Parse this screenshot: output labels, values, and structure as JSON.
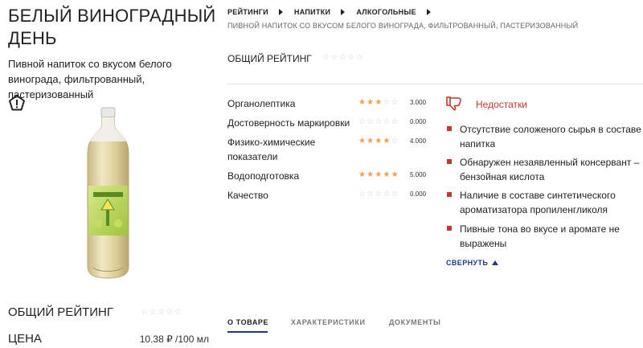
{
  "product": {
    "title": "БЕЛЫЙ ВИНОГРАДНЫЙ ДЕНЬ",
    "subtitle": "Пивной напиток со вкусом белого винограда, фильтрованный, пастеризованный",
    "overall_rating_label": "ОБЩИЙ РЕЙТИНГ",
    "overall_stars": "☆☆☆☆☆",
    "price_label": "ЦЕНА",
    "price_value": "10.38 ₽ /100 мл"
  },
  "breadcrumb": {
    "items": [
      "РЕЙТИНГИ",
      "НАПИТКИ",
      "АЛКОГОЛЬНЫЕ"
    ],
    "subline": "ПИВНОЙ НАПИТОК СО ВКУСОМ БЕЛОГО ВИНОГРАДА, ФИЛЬТРОВАННЫЙ, ПАСТЕРИЗОВАННЫЙ"
  },
  "overall": {
    "label": "ОБЩИЙ РЕЙТИНГ",
    "stars": "☆☆☆☆☆"
  },
  "criteria": [
    {
      "label": "Органолептика",
      "stars": 3,
      "value": "3.000"
    },
    {
      "label": "Достоверность маркировки",
      "stars": 0,
      "value": "0.000"
    },
    {
      "label": "Физико-химические показатели",
      "stars": 4,
      "value": "4.000"
    },
    {
      "label": "Водоподготовка",
      "stars": 5,
      "value": "5.000"
    },
    {
      "label": "Качество",
      "stars": 0,
      "value": "0.000"
    }
  ],
  "defects": {
    "title": "Недостатки",
    "items": [
      "Отсутствие соложеного сырья в составе напитка",
      "Обнаружен незаявленный консервант – бензойная кислота",
      "Наличие в составе синтетического ароматизатора пропиленгликоля",
      "Пивные тона во вкусе и аромате не выражены"
    ],
    "collapse_label": "СВЕРНУТЬ"
  },
  "tabs": [
    {
      "label": "О ТОВАРЕ",
      "active": true
    },
    {
      "label": "ХАРАКТЕРИСТИКИ",
      "active": false
    },
    {
      "label": "ДОКУМЕНТЫ",
      "active": false
    }
  ],
  "colors": {
    "accent_blue": "#1f3a8a",
    "defect_red": "#c3392f",
    "star_on": "#f0a04b",
    "star_off": "#cfcfcf"
  },
  "icons": {
    "warning": "pentagon-exclamation-icon",
    "defects": "thumbs-down-icon"
  }
}
